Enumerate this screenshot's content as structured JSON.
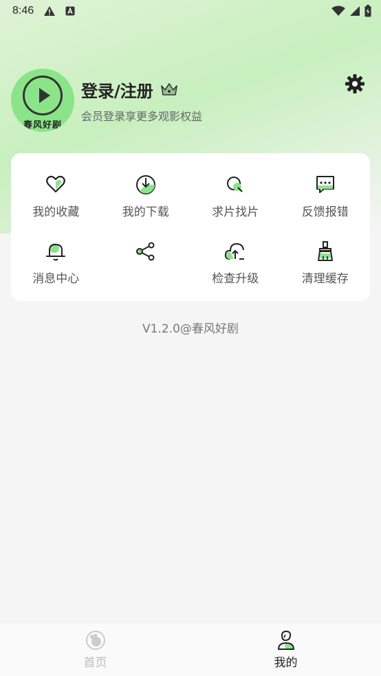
{
  "status_bar": {
    "time": "8:46",
    "icons": [
      "warning-icon",
      "text-icon",
      "wifi-icon",
      "signal-icon",
      "battery-icon"
    ]
  },
  "colors": {
    "accent": "#7fe07c",
    "background": "#f5f5f5",
    "gradient_top": "#c8efbe"
  },
  "profile": {
    "avatar_text": "春风好剧",
    "login_title": "登录/注册",
    "login_subtitle": "会员登录享更多观影权益",
    "vip_icon": "crown-icon",
    "settings_icon": "gear-icon"
  },
  "menu": {
    "items": [
      {
        "label": "我的收藏",
        "icon": "heart-icon"
      },
      {
        "label": "我的下载",
        "icon": "download-icon"
      },
      {
        "label": "求片找片",
        "icon": "search-film-icon"
      },
      {
        "label": "反馈报错",
        "icon": "feedback-icon"
      },
      {
        "label": "消息中心",
        "icon": "bell-icon"
      },
      {
        "label": "",
        "icon": "share-icon"
      },
      {
        "label": "检查升级",
        "icon": "upgrade-icon"
      },
      {
        "label": "清理缓存",
        "icon": "broom-icon"
      }
    ]
  },
  "version": "V1.2.0@春风好剧",
  "tab_bar": {
    "tabs": [
      {
        "label": "首页",
        "icon": "home-icon",
        "active": false
      },
      {
        "label": "我的",
        "icon": "profile-icon",
        "active": true
      }
    ]
  }
}
